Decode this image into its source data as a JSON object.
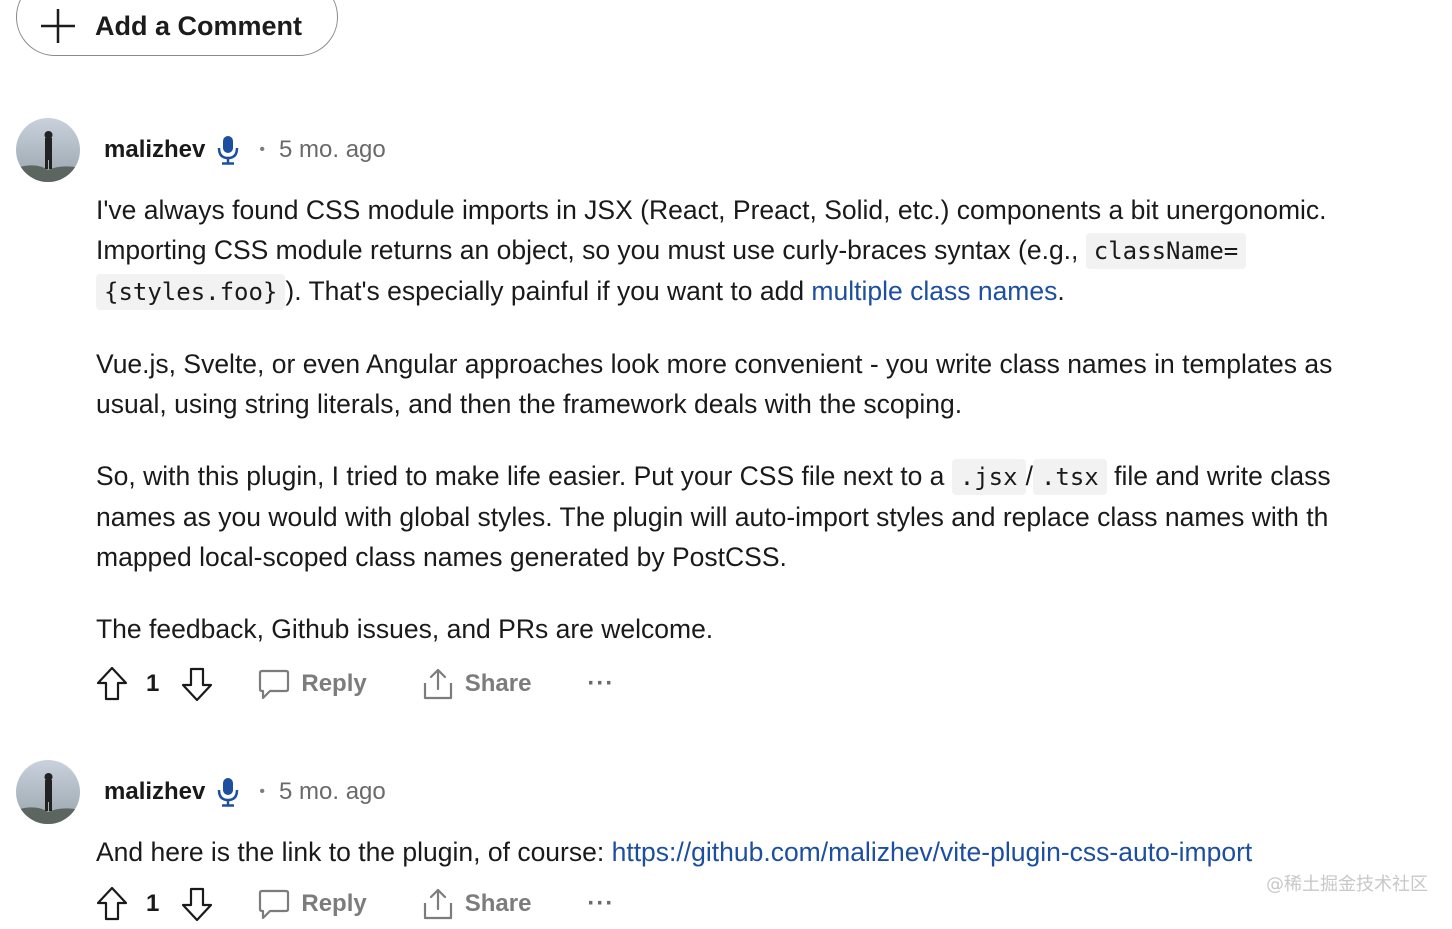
{
  "add_comment": {
    "label": "Add a Comment"
  },
  "comments": [
    {
      "author": "malizhev",
      "time": "5 mo. ago",
      "separator": "•",
      "paragraphs": {
        "p1_a": "I've always found CSS module imports in JSX (React, Preact, Solid, etc.) components a bit unergonomic.",
        "p1_b": "Importing CSS module returns an object, so you must use curly-braces syntax (e.g., ",
        "p1_code1": "className=",
        "p1_code2": "{styles.foo}",
        "p1_c": "). That's especially painful if you want to add ",
        "p1_link": "multiple class names",
        "p1_d": ".",
        "p2_a": "Vue.js, Svelte, or even Angular approaches look more convenient - you write class names in templates as",
        "p2_b": "usual, using string literals, and then the framework deals with the scoping.",
        "p3_a": "So, with this plugin, I tried to make life easier. Put your CSS file next to a ",
        "p3_code1": ".jsx",
        "p3_slash": "/",
        "p3_code2": ".tsx",
        "p3_b": " file and write class",
        "p3_c": "names as you would with global styles. The plugin will auto-import styles and replace class names with th",
        "p3_d": "mapped local-scoped class names generated by PostCSS.",
        "p4": "The feedback, Github issues, and PRs are welcome."
      },
      "votes": "1",
      "reply_label": "Reply",
      "share_label": "Share",
      "more_label": "···"
    },
    {
      "author": "malizhev",
      "time": "5 mo. ago",
      "separator": "•",
      "text": "And here is the link to the plugin, of course: ",
      "link": "https://github.com/malizhev/vite-plugin-css-auto-import",
      "votes": "1",
      "reply_label": "Reply",
      "share_label": "Share",
      "more_label": "···"
    }
  ],
  "watermark": "@稀土掘金技术社区",
  "colors": {
    "link": "#1d4fa0",
    "mic_icon": "#1d4fa0",
    "meta_gray": "#6a6a6a",
    "code_bg": "#f2f2f2"
  }
}
